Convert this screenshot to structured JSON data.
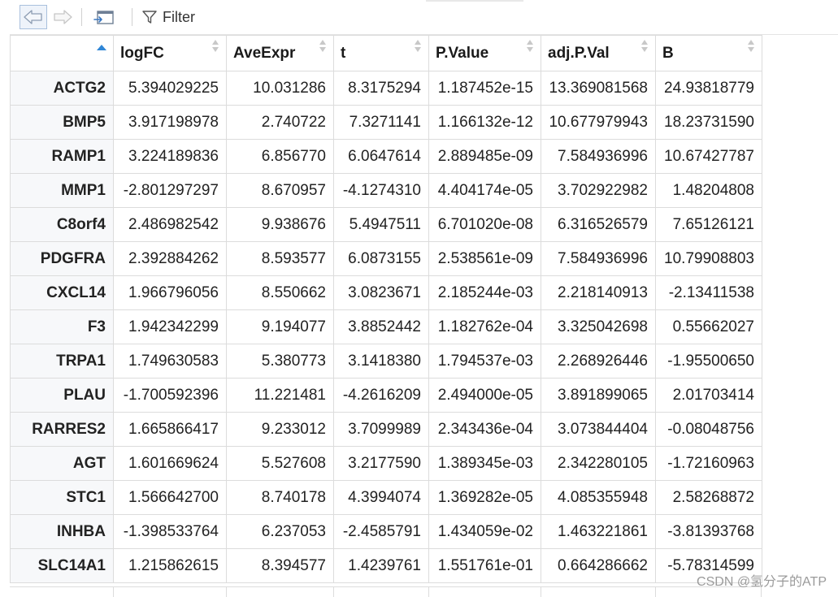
{
  "toolbar": {
    "back_icon": "arrow-left-icon",
    "forward_icon": "arrow-right-icon",
    "popout_icon": "popout-window-icon",
    "filter_icon": "funnel-icon",
    "filter_label": "Filter"
  },
  "table": {
    "sorted_column": "rownames",
    "sort_direction": "ascending",
    "columns": [
      "logFC",
      "AveExpr",
      "t",
      "P.Value",
      "adj.P.Val",
      "B"
    ],
    "rows": [
      {
        "name": "ACTG2",
        "cells": [
          "5.394029225",
          "10.031286",
          "8.3175294",
          "1.187452e-15",
          "13.369081568",
          "24.93818779"
        ]
      },
      {
        "name": "BMP5",
        "cells": [
          "3.917198978",
          "2.740722",
          "7.3271141",
          "1.166132e-12",
          "10.677979943",
          "18.23731590"
        ]
      },
      {
        "name": "RAMP1",
        "cells": [
          "3.224189836",
          "6.856770",
          "6.0647614",
          "2.889485e-09",
          "7.584936996",
          "10.67427787"
        ]
      },
      {
        "name": "MMP1",
        "cells": [
          "-2.801297297",
          "8.670957",
          "-4.1274310",
          "4.404174e-05",
          "3.702922982",
          "1.48204808"
        ]
      },
      {
        "name": "C8orf4",
        "cells": [
          "2.486982542",
          "9.938676",
          "5.4947511",
          "6.701020e-08",
          "6.316526579",
          "7.65126121"
        ]
      },
      {
        "name": "PDGFRA",
        "cells": [
          "2.392884262",
          "8.593577",
          "6.0873155",
          "2.538561e-09",
          "7.584936996",
          "10.79908803"
        ]
      },
      {
        "name": "CXCL14",
        "cells": [
          "1.966796056",
          "8.550662",
          "3.0823671",
          "2.185244e-03",
          "2.218140913",
          "-2.13411538"
        ]
      },
      {
        "name": "F3",
        "cells": [
          "1.942342299",
          "9.194077",
          "3.8852442",
          "1.182762e-04",
          "3.325042698",
          "0.55662027"
        ]
      },
      {
        "name": "TRPA1",
        "cells": [
          "1.749630583",
          "5.380773",
          "3.1418380",
          "1.794537e-03",
          "2.268926446",
          "-1.95500650"
        ]
      },
      {
        "name": "PLAU",
        "cells": [
          "-1.700592396",
          "11.221481",
          "-4.2616209",
          "2.494000e-05",
          "3.891899065",
          "2.01703414"
        ]
      },
      {
        "name": "RARRES2",
        "cells": [
          "1.665866417",
          "9.233012",
          "3.7099989",
          "2.343436e-04",
          "3.073844404",
          "-0.08048756"
        ]
      },
      {
        "name": "AGT",
        "cells": [
          "1.601669624",
          "5.527608",
          "3.2177590",
          "1.389345e-03",
          "2.342280105",
          "-1.72160963"
        ]
      },
      {
        "name": "STC1",
        "cells": [
          "1.566642700",
          "8.740178",
          "4.3994074",
          "1.369282e-05",
          "4.085355948",
          "2.58268872"
        ]
      },
      {
        "name": "INHBA",
        "cells": [
          "-1.398533764",
          "6.237053",
          "-2.4585791",
          "1.434059e-02",
          "1.463221861",
          "-3.81393768"
        ]
      },
      {
        "name": "SLC14A1",
        "cells": [
          "1.215862615",
          "8.394577",
          "1.4239761",
          "1.551761e-01",
          "0.664286662",
          "-5.78314599"
        ]
      }
    ]
  },
  "watermark": "CSDN @氢分子的ATP",
  "colors": {
    "sort_active": "#2f86d6",
    "grid_line": "#dcdcdc",
    "row_header_bg": "#f7f8fa"
  }
}
